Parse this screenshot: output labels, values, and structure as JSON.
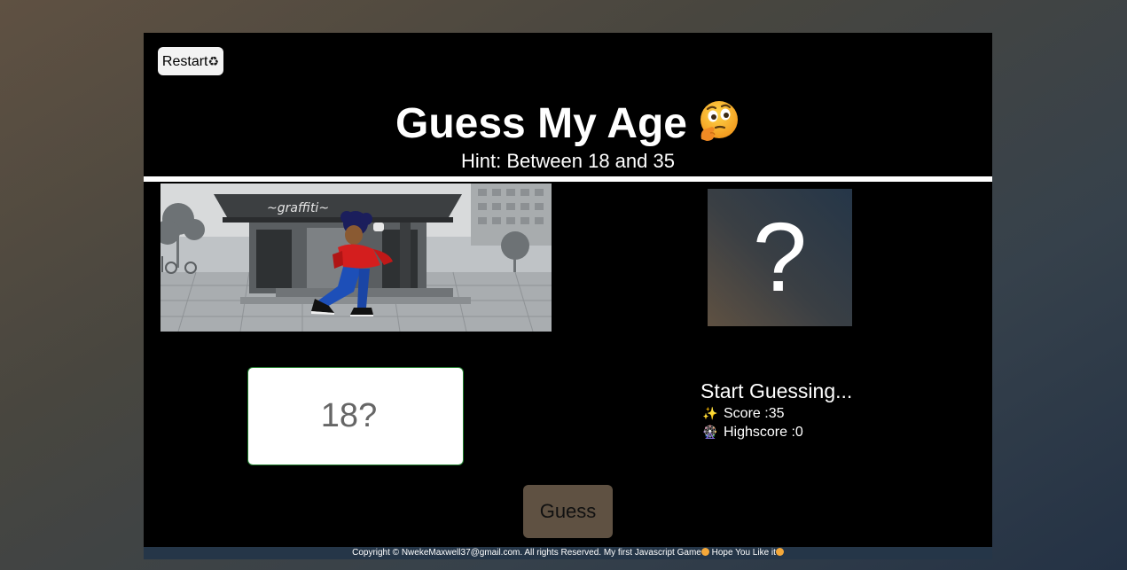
{
  "header": {
    "restart_label": "Restart",
    "restart_icon": "recycle-icon",
    "title": "Guess My Age",
    "title_icon": "thinking-face-icon",
    "hint": "Hint: Between 18 and 35"
  },
  "secret": {
    "value": "?"
  },
  "input": {
    "placeholder": "18?",
    "value": ""
  },
  "status": {
    "message": "Start Guessing...",
    "score_icon": "sparkles-icon",
    "score_label": "Score :35",
    "highscore_icon": "ferris-wheel-icon",
    "highscore_label": "Highscore :0"
  },
  "actions": {
    "guess_label": "Guess"
  },
  "footer": {
    "text": "Copyright © NwekeMaxwell37@gmail.com. All rights Reserved. My first Javascript Game",
    "text_tail": " Hope You Like it"
  },
  "colors": {
    "accent": "#5f5142",
    "panel": "#000000",
    "footer": "#253648"
  }
}
